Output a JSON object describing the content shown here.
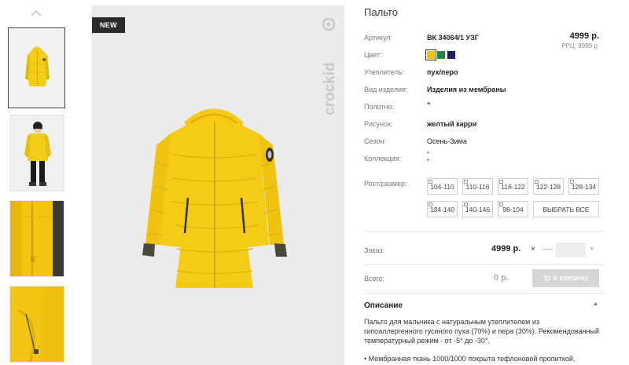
{
  "product": {
    "title": "Пальто",
    "badge_new": "NEW",
    "brand_logo_text": "crockid",
    "price": "4999 р.",
    "rrp": "РРЦ: 8999 р."
  },
  "attributes": [
    {
      "label": "Артикул:",
      "value": "ВК 34064/1 УЗГ"
    },
    {
      "label": "Цвет:",
      "value": ""
    },
    {
      "label": "Утеплитель:",
      "value": "пух/перо"
    },
    {
      "label": "Вид изделия:",
      "value": "Изделия из мембраны"
    },
    {
      "label": "Полотно:",
      "value": "\""
    },
    {
      "label": "Рисунок:",
      "value": "желтый карри"
    },
    {
      "label": "Сезон:",
      "value": "Осень-Зима"
    },
    {
      "label": "Коллекция:",
      "value": "\"\n\""
    },
    {
      "label": "Рост/размер:",
      "value": ""
    }
  ],
  "colors": [
    {
      "name": "yellow",
      "hex": "#f2c40f",
      "selected": true
    },
    {
      "name": "green",
      "hex": "#1e8a3c",
      "selected": false
    },
    {
      "name": "navy",
      "hex": "#1a1f6b",
      "selected": false
    }
  ],
  "sizes": [
    "104-110",
    "110-116",
    "116-122",
    "122-128",
    "128-134",
    "134-140",
    "140-146",
    "98-104"
  ],
  "select_all_label": "ВЫБРАТЬ ВСЕ",
  "order": {
    "label": "Заказ:",
    "price": "4999 р.",
    "remove_icon": "×",
    "minus": "—",
    "qty": "",
    "plus": "+"
  },
  "total": {
    "label": "Всего:",
    "value": "0 р.",
    "cart_button": "В КОРЗИНУ"
  },
  "description": {
    "title": "Описание",
    "text": "Пальто для мальчика с натуральным утеплителем из гипоаллергенного гусиного пуха (70%) и пера (30%). Рекомендованный температурный режим - от -5° до -30°.",
    "bullet": "• Мембранная ткань 1000/1000 покрыта тефлоновой пропиткой,"
  },
  "icons": {
    "thumbs_up": "chevron-up-icon",
    "cart": "cart-icon",
    "collapse": "chevron-up-icon"
  },
  "accent_color": "#f2c40f"
}
